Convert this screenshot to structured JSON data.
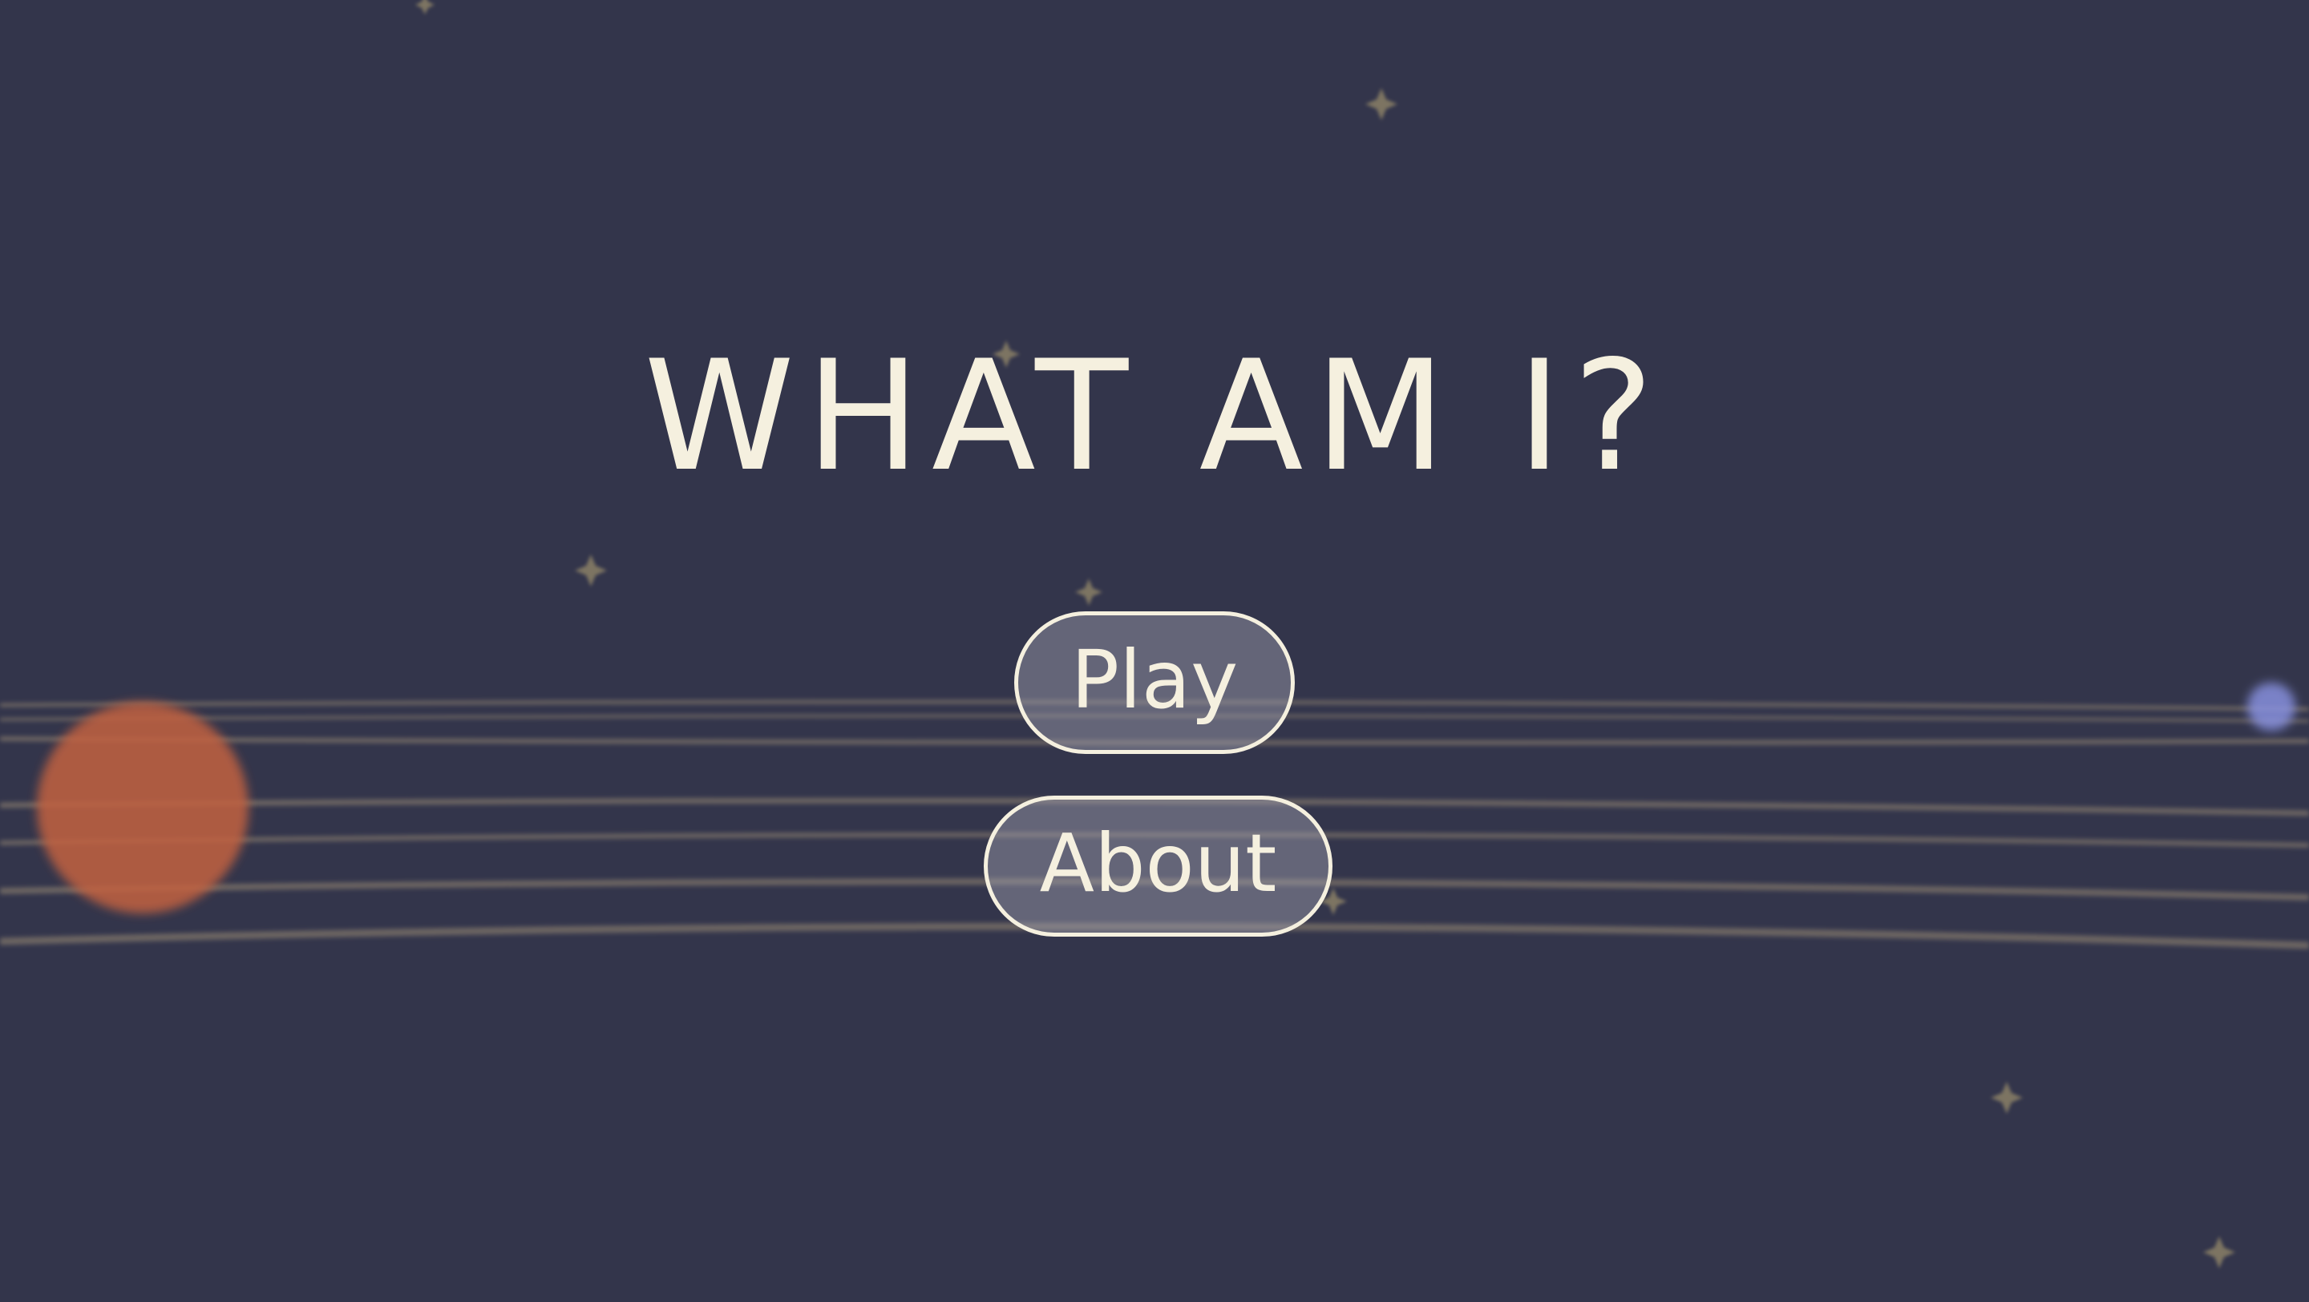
{
  "game": {
    "title": "WHAT AM I?",
    "menu": {
      "play_label": "Play",
      "about_label": "About"
    }
  },
  "colors": {
    "background": "#33354b",
    "text": "#f5f0df",
    "orbit_line": "#9a8c74",
    "star": "#8f8468",
    "planet_orange": "#c2603e",
    "planet_blue": "#8c95e6",
    "button_fill": "rgba(160,160,175,0.45)"
  },
  "icons": {
    "stars": "four-point-star-icon",
    "planets": "planet-icon"
  }
}
